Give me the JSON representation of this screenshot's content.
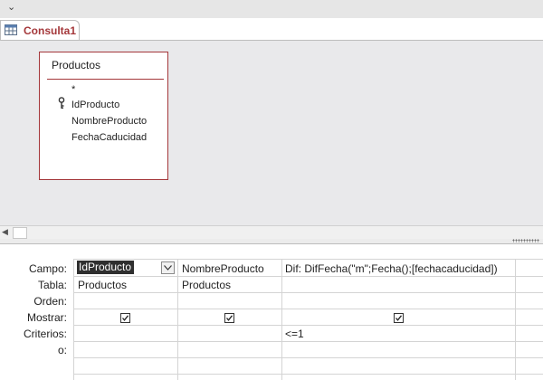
{
  "tab": {
    "title": "Consulta1",
    "icon": "query-icon"
  },
  "table_box": {
    "title": "Productos",
    "fields": [
      "*",
      "IdProducto",
      "NombreProducto",
      "FechaCaducidad"
    ],
    "primary_key_field": "IdProducto"
  },
  "grid": {
    "row_labels": {
      "campo": "Campo:",
      "tabla": "Tabla:",
      "orden": "Orden:",
      "mostrar": "Mostrar:",
      "criterios": "Criterios:",
      "o": "o:"
    },
    "columns": [
      {
        "campo": "IdProducto",
        "tabla": "Productos",
        "orden": "",
        "mostrar": true,
        "criterios": "",
        "o": ""
      },
      {
        "campo": "NombreProducto",
        "tabla": "Productos",
        "orden": "",
        "mostrar": true,
        "criterios": "",
        "o": ""
      },
      {
        "campo": "Dif: DifFecha(\"m\";Fecha();[fechacaducidad])",
        "tabla": "",
        "orden": "",
        "mostrar": true,
        "criterios": "<=1",
        "o": ""
      }
    ]
  },
  "colors": {
    "accent": "#a4373a",
    "design_bg": "#e9e9eb",
    "selection": "#2f2f2f"
  }
}
